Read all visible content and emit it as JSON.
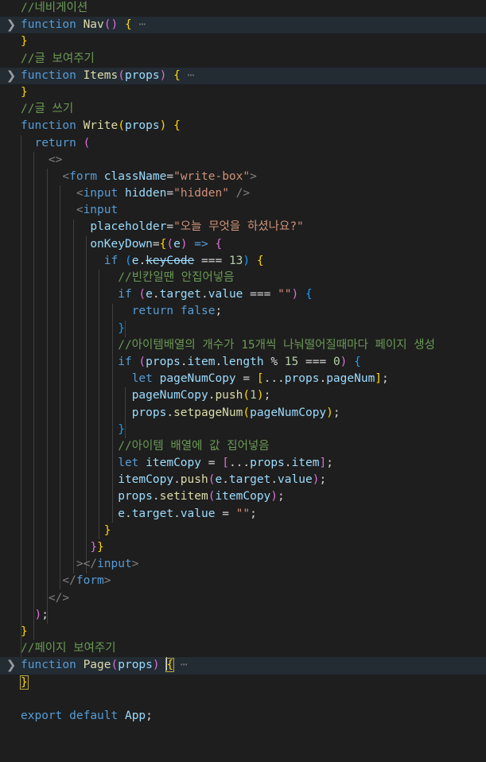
{
  "editor": {
    "theme": "dark-plus",
    "language": "javascriptreact",
    "background": "#1e1e1e",
    "highlight_background": "#232b33",
    "font_size_px": 14.5,
    "line_height_px": 21.2,
    "colors": {
      "keyword": "#569cd6",
      "function": "#dcdcaa",
      "variable": "#9cdcfe",
      "string": "#ce9178",
      "number": "#b5cea8",
      "comment": "#6a9955",
      "bracket_yellow": "#ffd700",
      "bracket_purple": "#da70d6",
      "bracket_blue": "#179fff",
      "indent_guide": "#404040",
      "bracket_match_outline": "#b5a642",
      "default_text": "#d4d4d4"
    },
    "fold_icon": "chevron-right-icon",
    "folded_placeholder": "⋯"
  },
  "lines": [
    {
      "n": 1,
      "folded": false,
      "text": "//네비게이션"
    },
    {
      "n": 2,
      "folded": true,
      "text": "function Nav() { ⋯"
    },
    {
      "n": 3,
      "folded": false,
      "text": "}"
    },
    {
      "n": 4,
      "folded": false,
      "text": "//글 보여주기"
    },
    {
      "n": 5,
      "folded": true,
      "text": "function Items(props) { ⋯"
    },
    {
      "n": 6,
      "folded": false,
      "text": "}"
    },
    {
      "n": 7,
      "folded": false,
      "text": "//글 쓰기"
    },
    {
      "n": 8,
      "folded": false,
      "text": "function Write(props) {"
    },
    {
      "n": 9,
      "folded": false,
      "text": "  return ("
    },
    {
      "n": 10,
      "folded": false,
      "text": "    <>"
    },
    {
      "n": 11,
      "folded": false,
      "text": "      <form className=\"write-box\">"
    },
    {
      "n": 12,
      "folded": false,
      "text": "        <input hidden=\"hidden\" />"
    },
    {
      "n": 13,
      "folded": false,
      "text": "        <input"
    },
    {
      "n": 14,
      "folded": false,
      "text": "          placeholder=\"오늘 무엇을 하셨나요?\""
    },
    {
      "n": 15,
      "folded": false,
      "text": "          onKeyDown={(e) => {"
    },
    {
      "n": 16,
      "folded": false,
      "text": "            if (e.keyCode === 13) {"
    },
    {
      "n": 17,
      "folded": false,
      "text": "              //빈칸일땐 안집어넣음"
    },
    {
      "n": 18,
      "folded": false,
      "text": "              if (e.target.value === \"\") {"
    },
    {
      "n": 19,
      "folded": false,
      "text": "                return false;"
    },
    {
      "n": 20,
      "folded": false,
      "text": "              }"
    },
    {
      "n": 21,
      "folded": false,
      "text": "              //아이템배열의 개수가 15개씩 나눠떨어질때마다 페이지 생성"
    },
    {
      "n": 22,
      "folded": false,
      "text": "              if (props.item.length % 15 === 0) {"
    },
    {
      "n": 23,
      "folded": false,
      "text": "                let pageNumCopy = [...props.pageNum];"
    },
    {
      "n": 24,
      "folded": false,
      "text": "                pageNumCopy.push(1);"
    },
    {
      "n": 25,
      "folded": false,
      "text": "                props.setpageNum(pageNumCopy);"
    },
    {
      "n": 26,
      "folded": false,
      "text": "              }"
    },
    {
      "n": 27,
      "folded": false,
      "text": "              //아이템 배열에 값 집어넣음"
    },
    {
      "n": 28,
      "folded": false,
      "text": "              let itemCopy = [...props.item];"
    },
    {
      "n": 29,
      "folded": false,
      "text": "              itemCopy.push(e.target.value);"
    },
    {
      "n": 30,
      "folded": false,
      "text": "              props.setitem(itemCopy);"
    },
    {
      "n": 31,
      "folded": false,
      "text": "              e.target.value = \"\";"
    },
    {
      "n": 32,
      "folded": false,
      "text": "            }"
    },
    {
      "n": 33,
      "folded": false,
      "text": "          }}"
    },
    {
      "n": 34,
      "folded": false,
      "text": "        ></input>"
    },
    {
      "n": 35,
      "folded": false,
      "text": "      </form>"
    },
    {
      "n": 36,
      "folded": false,
      "text": "    </>"
    },
    {
      "n": 37,
      "folded": false,
      "text": "  );"
    },
    {
      "n": 38,
      "folded": false,
      "text": "}"
    },
    {
      "n": 39,
      "folded": false,
      "text": "//페이지 보여주기"
    },
    {
      "n": 40,
      "folded": true,
      "text": "function Page(props) { ⋯"
    },
    {
      "n": 41,
      "folded": false,
      "text": "}"
    },
    {
      "n": 42,
      "folded": false,
      "text": ""
    },
    {
      "n": 43,
      "folded": false,
      "text": "export default App;"
    }
  ],
  "deprecated_tokens": [
    "keyCode"
  ],
  "bracket_match": {
    "open": "{",
    "close": "}",
    "open_line": 40,
    "close_line": 41
  },
  "cursor": {
    "line": 40,
    "column": 22
  }
}
